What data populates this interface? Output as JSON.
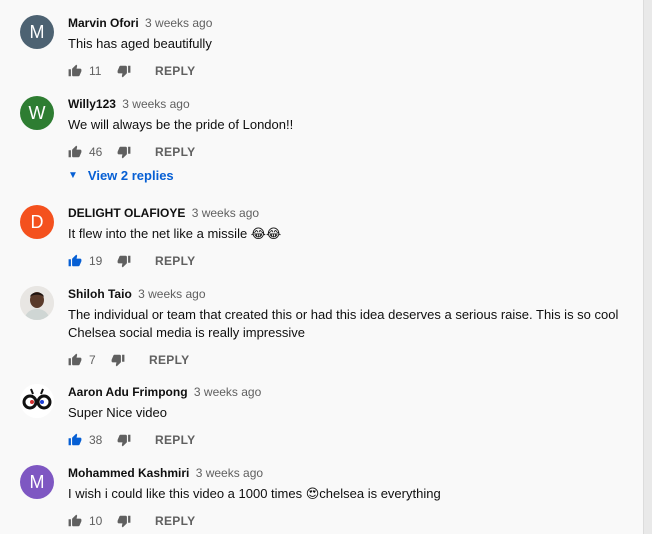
{
  "comments": [
    {
      "author": "Marvin Ofori",
      "time": "3 weeks ago",
      "text": "This has aged beautifully",
      "likes": "11",
      "avatar_letter": "M",
      "avatar_color": "#4d6272",
      "liked": false
    },
    {
      "author": "Willy123",
      "time": "3 weeks ago",
      "text": "We will always be the pride of London!!",
      "likes": "46",
      "avatar_letter": "W",
      "avatar_color": "#2e7d32",
      "liked": false,
      "view_replies": "View 2 replies"
    },
    {
      "author": "DELIGHT OLAFIOYE",
      "time": "3 weeks ago",
      "text": "It flew into the net like a missile 😂😂",
      "likes": "19",
      "avatar_letter": "D",
      "avatar_color": "#f4511e",
      "liked": true
    },
    {
      "author": "Shiloh Taio",
      "time": "3 weeks ago",
      "text_lines": [
        "The individual or team that created this or had this idea deserves a serious raise. This is so cool",
        "Chelsea social media is really impressive"
      ],
      "likes": "7",
      "avatar_letter": "",
      "avatar_color": "#8a6a5a",
      "liked": false
    },
    {
      "author": "Aaron Adu Frimpong",
      "time": "3 weeks ago",
      "text": "Super Nice video",
      "likes": "38",
      "avatar_letter": "",
      "avatar_color": "#ffffff",
      "liked": true
    },
    {
      "author": "Mohammed Kashmiri",
      "time": "3 weeks ago",
      "text": "I wish i could like this video a 1000 times 😍chelsea is everything",
      "likes": "10",
      "avatar_letter": "M",
      "avatar_color": "#7e57c2",
      "liked": false
    }
  ],
  "reply_label": "REPLY",
  "colors": {
    "link_blue": "#065fd4",
    "muted": "#606060",
    "liked_blue": "#065fd4"
  }
}
